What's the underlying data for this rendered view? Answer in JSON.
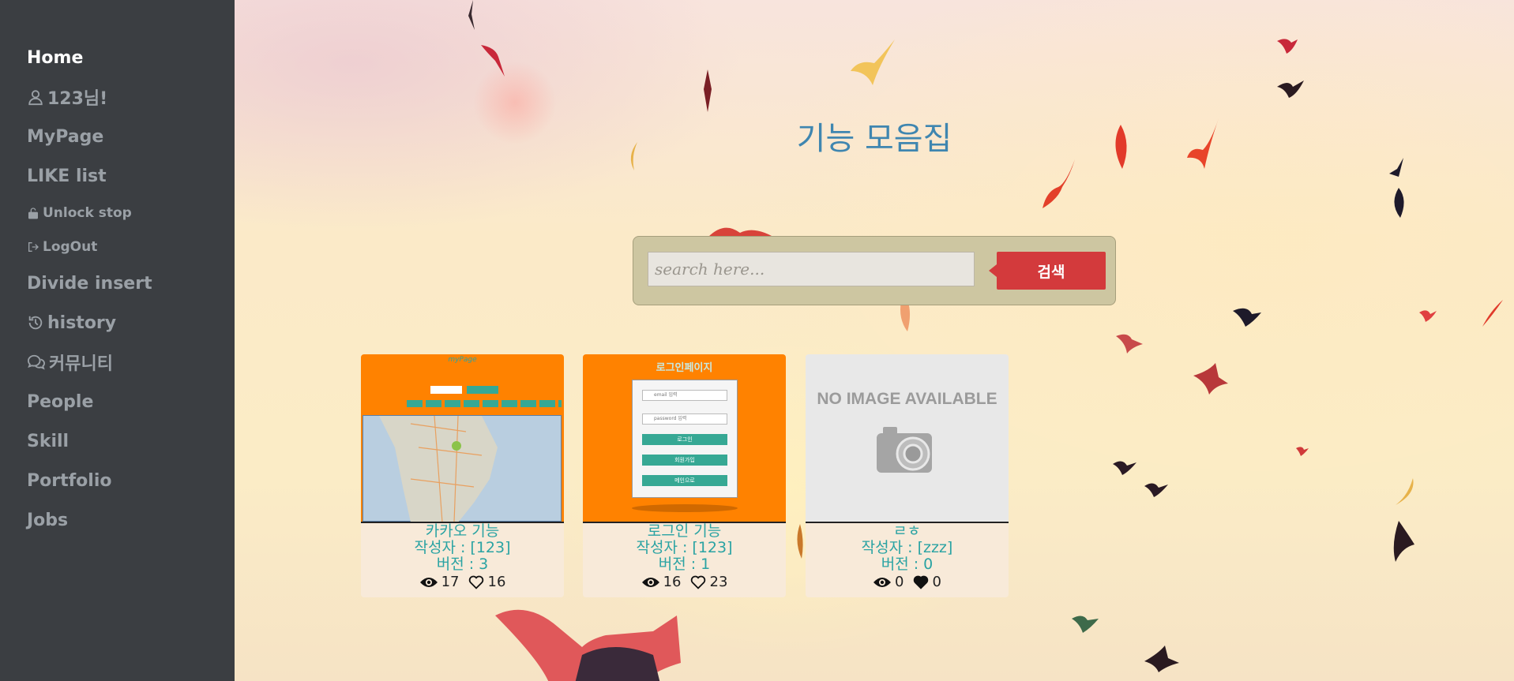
{
  "sidebar": {
    "items": [
      {
        "label": "Home"
      },
      {
        "label": "123님!",
        "icon": "user-icon"
      },
      {
        "label": "MyPage"
      },
      {
        "label": "LIKE list"
      },
      {
        "label": "Unlock stop",
        "icon": "unlock-icon"
      },
      {
        "label": "LogOut",
        "icon": "logout-icon"
      },
      {
        "label": "Divide insert"
      },
      {
        "label": "history",
        "icon": "history-icon"
      },
      {
        "label": "커뮤니티",
        "icon": "chat-icon"
      },
      {
        "label": "People"
      },
      {
        "label": "Skill"
      },
      {
        "label": "Portfolio"
      },
      {
        "label": "Jobs"
      }
    ]
  },
  "main": {
    "title": "기능 모음집",
    "search": {
      "placeholder": "search here...",
      "button_label": "검색"
    },
    "cards": [
      {
        "thumb_title": "myPage",
        "title": "카카오 기능",
        "author": "작성자 : [123]",
        "version": "버전 : 3",
        "views": "17",
        "likes": "16",
        "liked": false
      },
      {
        "thumb_title": "로그인페이지",
        "thumb_fields": [
          "email 입력",
          "password 입력"
        ],
        "thumb_buttons": [
          "로그인",
          "회원가입",
          "메인으로"
        ],
        "title": "로그인 기능",
        "author": "작성자 : [123]",
        "version": "버전 : 1",
        "views": "16",
        "likes": "23",
        "liked": false
      },
      {
        "thumb_title": "NO IMAGE AVAILABLE",
        "title": "ㄹㅎ",
        "author": "작성자 : [zzz]",
        "version": "버전 : 0",
        "views": "0",
        "likes": "0",
        "liked": true
      }
    ]
  },
  "colors": {
    "sidebar_bg": "#3b3e42",
    "title": "#3f86b0",
    "search_button": "#d33a3c",
    "card_text": "#2aa3a3"
  }
}
